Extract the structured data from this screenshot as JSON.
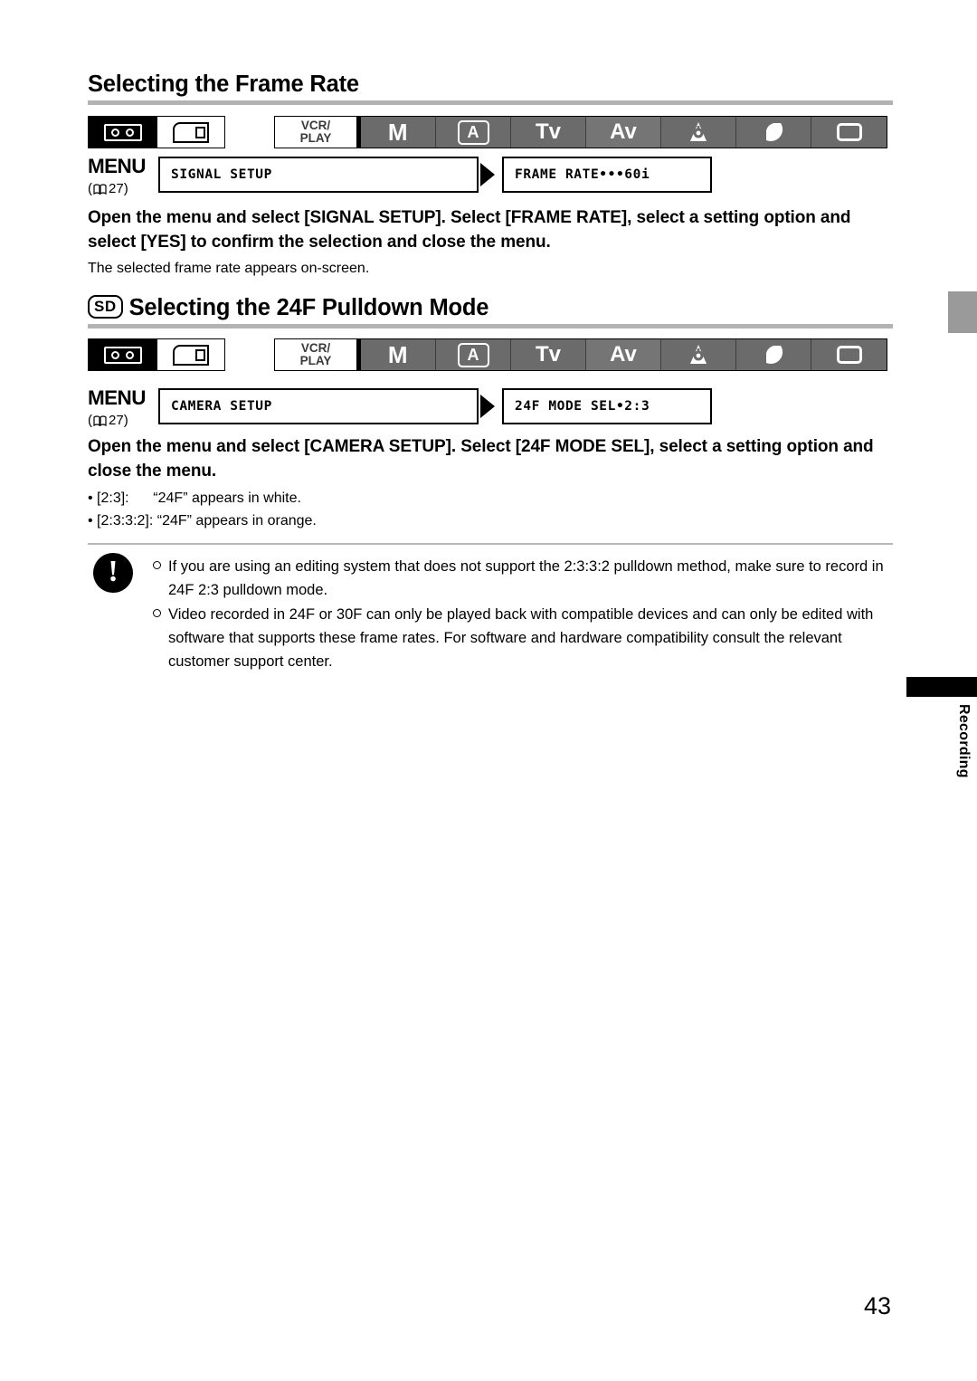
{
  "page": {
    "number": "43",
    "side_tab_label": "Recording"
  },
  "sections": [
    {
      "id": "frame-rate",
      "badge": "",
      "title": "Selecting the Frame Rate",
      "media": {
        "tape_icon": "tape-cassette-icon",
        "card_icon": "sd-card-icon"
      },
      "modes": {
        "vcr_play": "VCR/\nPLAY",
        "vcr_play_line1": "VCR/",
        "vcr_play_line2": "PLAY",
        "manual": "M",
        "auto": "A",
        "tv": "Tv",
        "av": "Av",
        "spotlight_icon": "spotlight-icon",
        "night_icon": "night-moon-icon",
        "easy_icon": "easy-rectangle-icon"
      },
      "menu": {
        "label": "MENU",
        "ref_open": "(",
        "ref_page": "27",
        "ref_close": ")",
        "book_icon": "open-book-icon",
        "first_item": "SIGNAL SETUP",
        "arrow_icon": "right-triangle-icon",
        "second_item": "FRAME RATE•••60i"
      },
      "instruction": "Open the menu and select [SIGNAL SETUP]. Select [FRAME RATE], select a setting option and select [YES] to confirm the selection and close the menu.",
      "subtext": "The selected frame rate appears on-screen.",
      "bullets": []
    },
    {
      "id": "pulldown-mode",
      "badge": "SD",
      "title": "Selecting the 24F Pulldown Mode",
      "media": {
        "tape_icon": "tape-cassette-icon",
        "card_icon": "sd-card-icon"
      },
      "modes": {
        "vcr_play_line1": "VCR/",
        "vcr_play_line2": "PLAY",
        "manual": "M",
        "auto": "A",
        "tv": "Tv",
        "av": "Av",
        "spotlight_icon": "spotlight-icon",
        "night_icon": "night-moon-icon",
        "easy_icon": "easy-rectangle-icon"
      },
      "menu": {
        "label": "MENU",
        "ref_open": "(",
        "ref_page": "27",
        "ref_close": ")",
        "book_icon": "open-book-icon",
        "first_item": "CAMERA SETUP",
        "arrow_icon": "right-triangle-icon",
        "second_item": "24F MODE SEL•2:3"
      },
      "instruction": "Open the menu and select [CAMERA SETUP]. Select [24F MODE SEL], select a setting option and close the menu.",
      "subtext": "",
      "bullets": [
        "• [2:3]:      “24F” appears in white.",
        "• [2:3:3:2]: “24F” appears in orange."
      ]
    }
  ],
  "note": {
    "icon": "exclamation-warning-icon",
    "items": [
      "If you are using an editing system that does not support the 2:3:3:2 pulldown method, make sure to record in 24F 2:3 pulldown mode.",
      "Video recorded in 24F or 30F can only be played back with compatible devices and can only be edited with software that supports these frame rates. For software and hardware compatibility consult the relevant customer support center."
    ]
  },
  "colors": {
    "mode_bar": "#6b6b6b",
    "mode_bar_highlight": "#757575",
    "rule": "#b3b3b3",
    "edge_tab": "#9a9a9a"
  }
}
